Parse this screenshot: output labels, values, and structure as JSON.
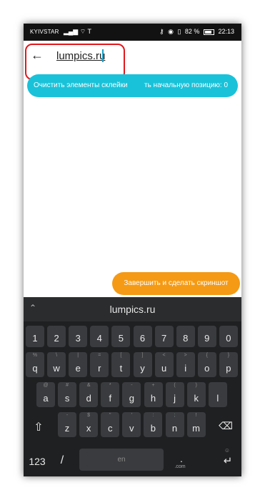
{
  "status": {
    "carrier": "KYIVSTAR",
    "battery": "82 %",
    "time": "22:13"
  },
  "appbar": {
    "url_text": "lumpics.ru"
  },
  "pill": {
    "left_label": "Очистить элементы склейки",
    "right_label": "ть начальную позицию: 0"
  },
  "finish_button": "Завершить и сделать скриншот",
  "keyboard": {
    "suggestion": "lumpics.ru",
    "numbers": [
      "1",
      "2",
      "3",
      "4",
      "5",
      "6",
      "7",
      "8",
      "9",
      "0"
    ],
    "row_q": [
      "q",
      "w",
      "e",
      "r",
      "t",
      "y",
      "u",
      "i",
      "o",
      "p"
    ],
    "row_q_alt": [
      "%",
      "\\",
      "|",
      "=",
      "[",
      "]",
      "<",
      ">",
      "{",
      "}"
    ],
    "row_a": [
      "a",
      "s",
      "d",
      "f",
      "g",
      "h",
      "j",
      "k",
      "l"
    ],
    "row_a_alt": [
      "@",
      "#",
      "&",
      "*",
      "-",
      "+",
      "(",
      ")",
      ""
    ],
    "row_z": [
      "z",
      "x",
      "c",
      "v",
      "b",
      "n",
      "m"
    ],
    "row_z_alt": [
      "-",
      "$",
      "\"",
      "'",
      ":",
      ";",
      "!",
      ""
    ],
    "mode_key": "123",
    "slash_key": "/",
    "space_label": "en",
    "com_label": ".com",
    "dot_key": "."
  },
  "colors": {
    "pill": "#19c2d9",
    "finish": "#f59a14",
    "highlight": "#e0191e",
    "keyboard_bg": "#1f2022"
  }
}
